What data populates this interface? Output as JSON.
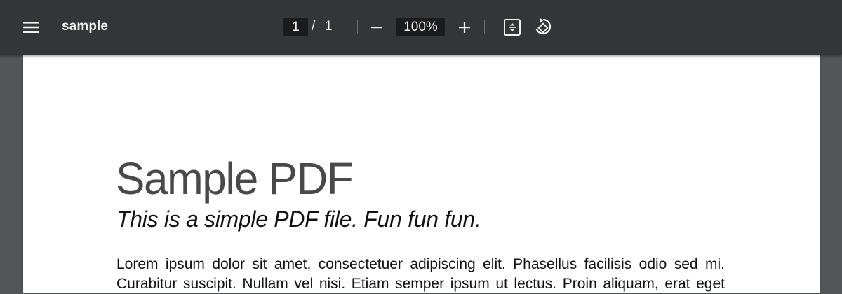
{
  "toolbar": {
    "menu_icon": "hamburger-menu-icon",
    "title": "sample",
    "page_current": "1",
    "page_separator": "/",
    "page_total": "1",
    "zoom_out_icon": "minus-icon",
    "zoom_level": "100%",
    "zoom_in_icon": "plus-icon",
    "fit_icon": "fit-to-page-icon",
    "rotate_icon": "rotate-counterclockwise-icon"
  },
  "document": {
    "heading": "Sample PDF",
    "subheading": "This is a simple PDF file. Fun fun fun.",
    "body_lines": [
      "Lorem ipsum dolor sit amet, consectetuer adipiscing elit. Phasellus facilisis odio sed mi.",
      "Curabitur suscipit. Nullam vel nisi. Etiam semper ipsum ut lectus. Proin aliquam, erat eget"
    ]
  },
  "colors": {
    "toolbar_bg": "#323639",
    "viewer_bg": "#525659",
    "page_bg": "#ffffff",
    "input_bg": "#191b1c",
    "toolbar_text": "#f1f1f1"
  }
}
